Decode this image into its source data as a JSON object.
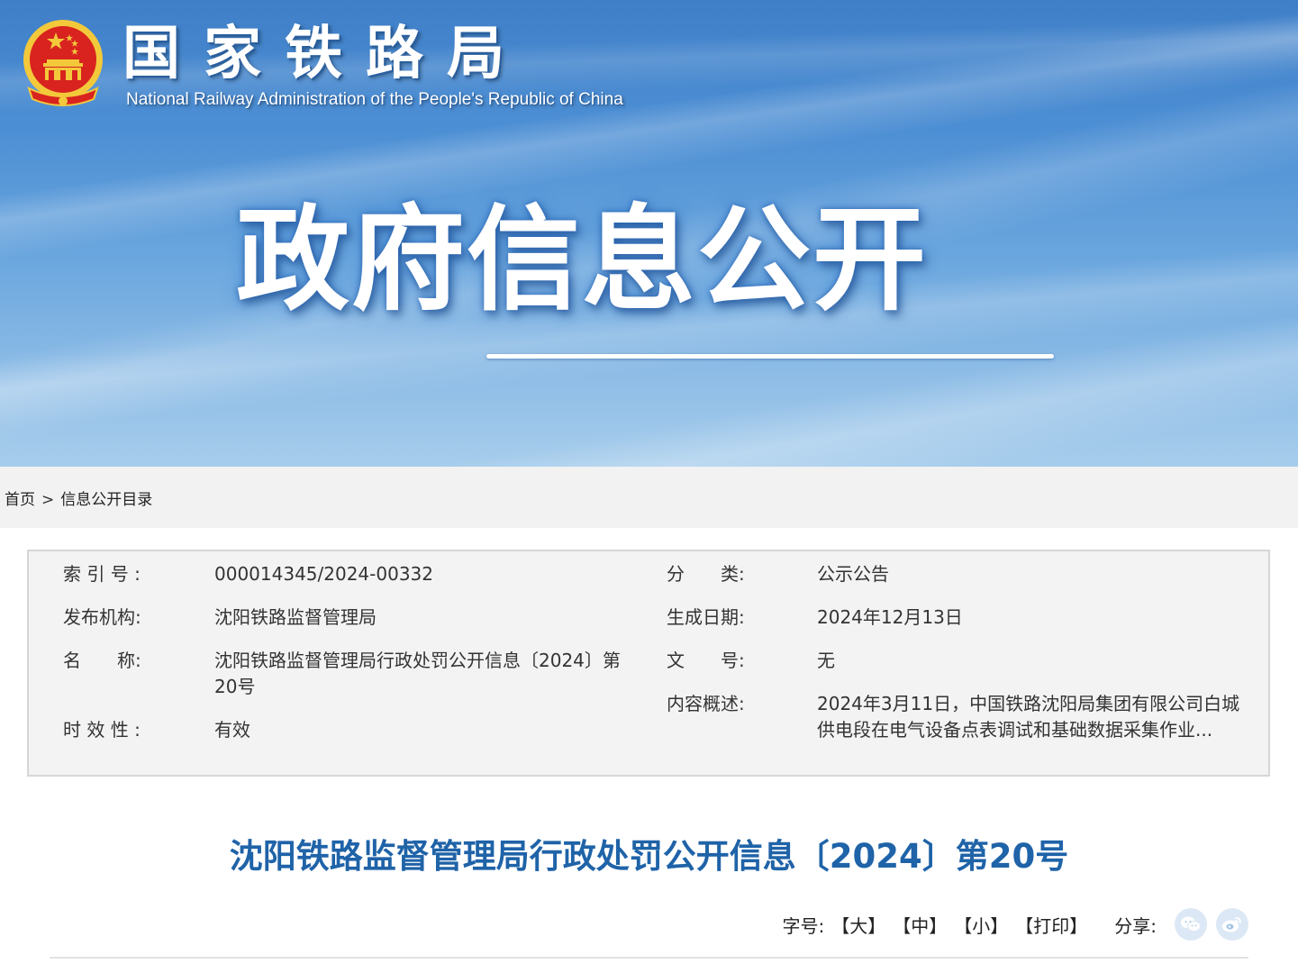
{
  "header": {
    "org_name_cn": "国家铁路局",
    "org_name_en": "National Railway Administration of the People's Republic of China",
    "banner_title": "政府信息公开"
  },
  "breadcrumb": {
    "home": "首页",
    "separator": ">",
    "current": "信息公开目录"
  },
  "info": {
    "index_label": "索 引 号 :",
    "index_value": "000014345/2024-00332",
    "category_label": "分　　类:",
    "category_value": "公示公告",
    "publisher_label": "发布机构:",
    "publisher_value": "沈阳铁路监督管理局",
    "date_label": "生成日期:",
    "date_value": "2024年12月13日",
    "name_label": "名　　称:",
    "name_value": "沈阳铁路监督管理局行政处罚公开信息〔2024〕第20号",
    "doc_no_label": "文　　号:",
    "doc_no_value": "无",
    "summary_label": "内容概述:",
    "summary_value": "2024年3月11日，中国铁路沈阳局集团有限公司白城供电段在电气设备点表调试和基础数据采集作业...",
    "validity_label": "时 效 性 :",
    "validity_value": "有效"
  },
  "article": {
    "title": "沈阳铁路监督管理局行政处罚公开信息〔2024〕第20号"
  },
  "toolbar": {
    "font_size_label": "字号:",
    "large": "【大】",
    "medium": "【中】",
    "small": "【小】",
    "print": "【打印】",
    "share_label": "分享:"
  },
  "icons": {
    "emblem": "national-emblem-icon",
    "share_wechat": "wechat-icon",
    "share_weibo": "weibo-icon"
  },
  "colors": {
    "title_blue": "#1f63a8",
    "emblem_red": "#d8231f",
    "emblem_gold": "#f3c93b",
    "share_icon": "#9fc3e6"
  }
}
